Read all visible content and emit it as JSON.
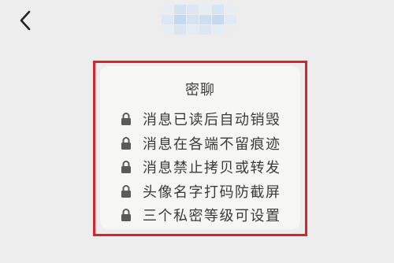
{
  "header": {
    "back_icon": "chevron-left-icon",
    "title_pixelated": true
  },
  "secret_chat": {
    "title": "密聊",
    "lock_icon": "lock-icon",
    "features": [
      "消息已读后自动销毁",
      "消息在各端不留痕迹",
      "消息禁止拷贝或转发",
      "头像名字打码防截屏",
      "三个私密等级可设置"
    ]
  },
  "colors": {
    "background": "#ededed",
    "card": "#f6f7f5",
    "highlight_border": "#d5242b",
    "text": "#3a3a3a"
  }
}
